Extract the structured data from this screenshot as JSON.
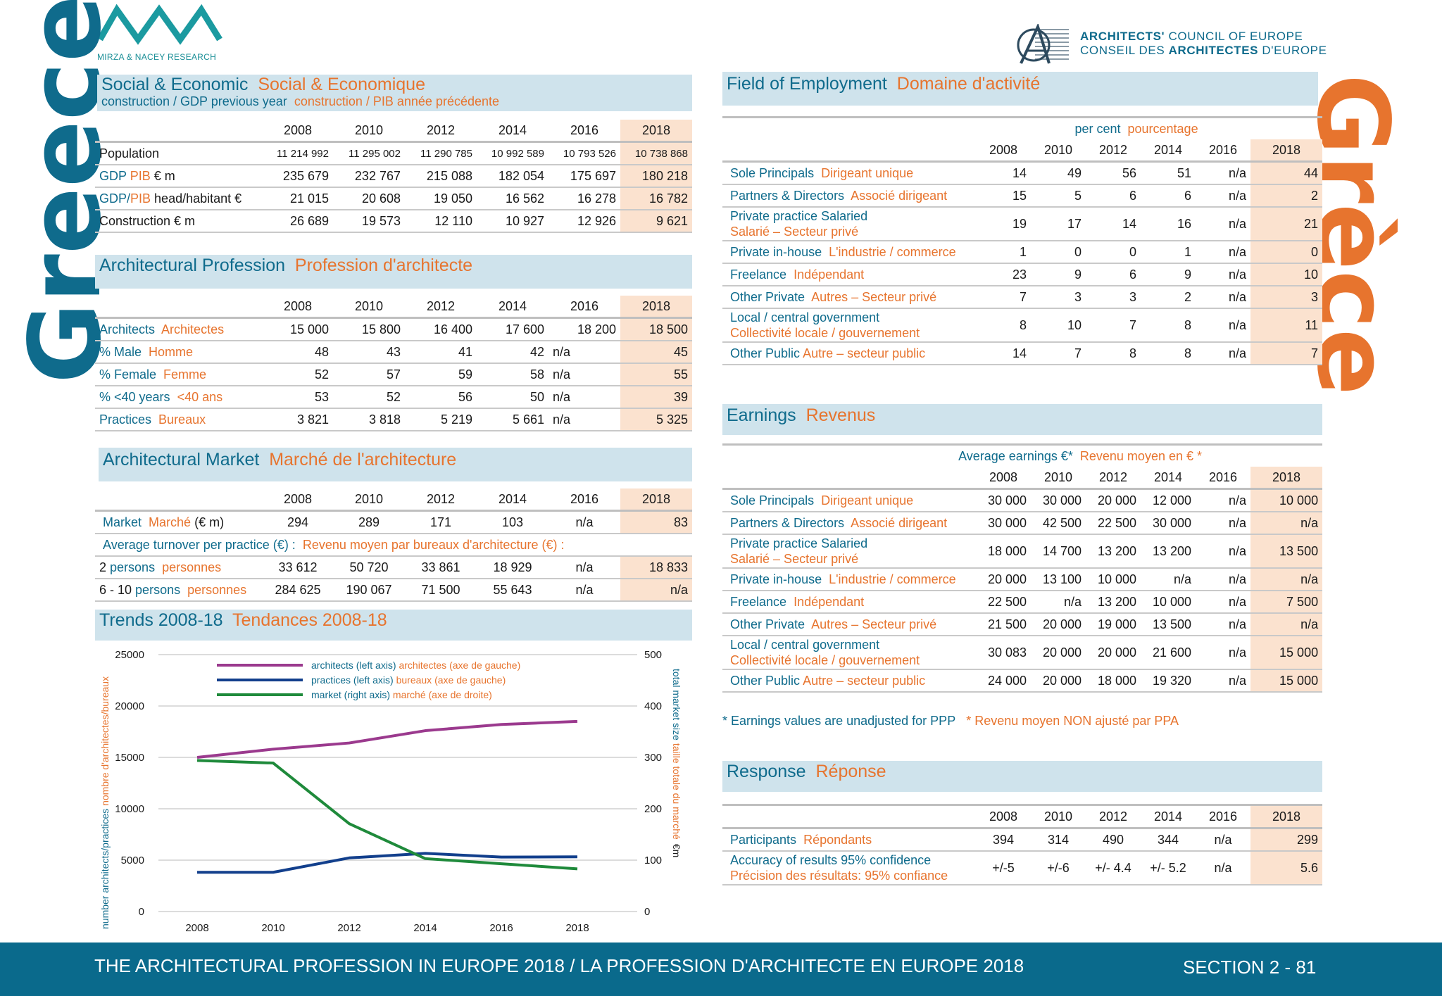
{
  "header": {
    "mnr_label": "MIRZA & NACEY RESEARCH",
    "ace_line1_prefix": "ARCHITECTS'",
    "ace_line1_suffix": " COUNCIL OF EUROPE",
    "ace_line2_prefix": "CONSEIL DES ",
    "ace_line2_bold": "ARCHITECTES",
    "ace_line2_suffix": " D'EUROPE"
  },
  "side": {
    "en": "Greece",
    "fr": "Grèce"
  },
  "years": [
    "2008",
    "2010",
    "2012",
    "2014",
    "2016",
    "2018"
  ],
  "social": {
    "title_en": "Social & Economic",
    "title_fr": "Social & Economique",
    "sub_en": "construction / GDP previous year",
    "sub_fr": "construction / PIB année précédente",
    "rows": [
      {
        "label_en": "Population",
        "label_fr": "",
        "unit": "",
        "values": [
          "11 214 992",
          "11 295 002",
          "11 290 785",
          "10 992 589",
          "10 793 526",
          "10 738 868"
        ]
      },
      {
        "label_en": "GDP",
        "label_fr": "PIB",
        "unit": "€ m",
        "values": [
          "235 679",
          "232 767",
          "215 088",
          "182 054",
          "175 697",
          "180 218"
        ]
      },
      {
        "label_en": "GDP/",
        "label_fr": "PIB",
        "unit": "head/habitant €",
        "values": [
          "21 015",
          "20 608",
          "19 050",
          "16 562",
          "16 278",
          "16 782"
        ]
      },
      {
        "label_en": "Construction € m",
        "label_fr": "",
        "unit": "",
        "values": [
          "26 689",
          "19 573",
          "12 110",
          "10 927",
          "12 926",
          "9 621"
        ]
      }
    ]
  },
  "profession": {
    "title_en": "Architectural Profession",
    "title_fr": "Profession d'architecte",
    "rows": [
      {
        "label_en": "Architects",
        "label_fr": "Architectes",
        "values": [
          "15 000",
          "15 800",
          "16 400",
          "17 600",
          "18 200",
          "18 500"
        ]
      },
      {
        "label_en": "% Male",
        "label_fr": "Homme",
        "values": [
          "48",
          "43",
          "41",
          "42",
          "n/a",
          "45"
        ]
      },
      {
        "label_en": "% Female",
        "label_fr": "Femme",
        "values": [
          "52",
          "57",
          "59",
          "58",
          "n/a",
          "55"
        ]
      },
      {
        "label_en": "% <40 years",
        "label_fr": "<40 ans",
        "values": [
          "53",
          "52",
          "56",
          "50",
          "n/a",
          "39"
        ]
      },
      {
        "label_en": "Practices",
        "label_fr": "Bureaux",
        "values": [
          "3 821",
          "3 818",
          "5 219",
          "5 661",
          "n/a",
          "5 325"
        ]
      }
    ]
  },
  "market": {
    "title_en": "Architectural Market",
    "title_fr": "Marché de l'architecture",
    "market_row": {
      "label_en": "Market",
      "label_fr": "Marché",
      "unit": "(€ m)",
      "values": [
        "294",
        "289",
        "171",
        "103",
        "n/a",
        "83"
      ]
    },
    "turnover_en": "Average turnover per practice (€) :",
    "turnover_fr": "Revenu moyen par bureaux d'architecture (€) :",
    "rows": [
      {
        "prefix": "2",
        "label_en": "persons",
        "label_fr": "personnes",
        "values": [
          "33 612",
          "50 720",
          "33 861",
          "18 929",
          "n/a",
          "18 833"
        ]
      },
      {
        "prefix": "6 - 10",
        "label_en": "persons",
        "label_fr": "personnes",
        "values": [
          "284 625",
          "190 067",
          "71 500",
          "55 643",
          "n/a",
          "n/a"
        ]
      }
    ]
  },
  "trends": {
    "title_en": "Trends 2008-18",
    "title_fr": "Tendances 2008-18"
  },
  "chart_data": {
    "type": "line",
    "x": [
      "2008",
      "2010",
      "2012",
      "2014",
      "2016",
      "2018"
    ],
    "left_ylim": [
      0,
      25000
    ],
    "left_ticks": [
      "0",
      "5000",
      "10000",
      "15000",
      "20000",
      "25000"
    ],
    "right_ylim": [
      0,
      500
    ],
    "right_ticks": [
      "0",
      "100",
      "200",
      "300",
      "400",
      "500"
    ],
    "ylabel_left_en": "number architects/practices",
    "ylabel_left_fr": "nombre d'architectes/bureaux",
    "ylabel_right_en": "total market size",
    "ylabel_right_fr": "taille totale du marché",
    "ylabel_right_unit": "€m",
    "grid": true,
    "series": [
      {
        "name": "architects (left axis)",
        "name_fr": "architectes (axe de gauche)",
        "axis": "left",
        "color": "#9b3a8e",
        "values": [
          15000,
          15800,
          16400,
          17600,
          18200,
          18500
        ]
      },
      {
        "name": "practices (left axis)",
        "name_fr": "bureaux (axe de gauche)",
        "axis": "left",
        "color": "#123f8c",
        "values": [
          3821,
          3818,
          5219,
          5661,
          5300,
          5325
        ]
      },
      {
        "name": "market (right axis)",
        "name_fr": "marché (axe de droite)",
        "axis": "right",
        "color": "#1f8a3b",
        "values": [
          294,
          289,
          171,
          103,
          93,
          83
        ]
      }
    ]
  },
  "employment": {
    "title_en": "Field of Employment",
    "title_fr": "Domaine d'activité",
    "unit_en": "per cent",
    "unit_fr": "pourcentage",
    "rows": [
      {
        "label_en": "Sole Principals",
        "label_fr": "Dirigeant unique",
        "values": [
          "14",
          "49",
          "56",
          "51",
          "n/a",
          "44"
        ]
      },
      {
        "label_en": "Partners & Directors",
        "label_fr": "Associé  dirigeant",
        "values": [
          "15",
          "5",
          "6",
          "6",
          "n/a",
          "2"
        ]
      },
      {
        "label_en": "Private practice Salaried",
        "label_fr": "Salarié – Secteur privé",
        "values": [
          "19",
          "17",
          "14",
          "16",
          "n/a",
          "21"
        ]
      },
      {
        "label_en": "Private in-house",
        "label_fr": "L'industrie / commerce",
        "values": [
          "1",
          "0",
          "0",
          "1",
          "n/a",
          "0"
        ]
      },
      {
        "label_en": "Freelance",
        "label_fr": "Indépendant",
        "values": [
          "23",
          "9",
          "6",
          "9",
          "n/a",
          "10"
        ]
      },
      {
        "label_en": "Other Private",
        "label_fr": "Autres – Secteur privé",
        "values": [
          "7",
          "3",
          "3",
          "2",
          "n/a",
          "3"
        ]
      },
      {
        "label_en": "Local / central government",
        "label_fr": "Collectivité locale / gouvernement",
        "values": [
          "8",
          "10",
          "7",
          "8",
          "n/a",
          "11"
        ]
      },
      {
        "label_en": "Other Public",
        "label_fr": "Autre – secteur public",
        "values": [
          "14",
          "7",
          "8",
          "8",
          "n/a",
          "7"
        ]
      }
    ]
  },
  "earnings": {
    "title_en": "Earnings",
    "title_fr": "Revenus",
    "unit_en": "Average earnings €*",
    "unit_fr": "Revenu moyen en € *",
    "rows": [
      {
        "label_en": "Sole Principals",
        "label_fr": "Dirigeant unique",
        "values": [
          "30 000",
          "30 000",
          "20 000",
          "12 000",
          "n/a",
          "10 000"
        ]
      },
      {
        "label_en": "Partners & Directors",
        "label_fr": "Associé  dirigeant",
        "values": [
          "30 000",
          "42 500",
          "22 500",
          "30 000",
          "n/a",
          "n/a"
        ]
      },
      {
        "label_en": "Private practice Salaried",
        "label_fr": "Salarié – Secteur privé",
        "values": [
          "18 000",
          "14 700",
          "13 200",
          "13 200",
          "n/a",
          "13 500"
        ]
      },
      {
        "label_en": "Private in-house",
        "label_fr": "L'industrie / commerce",
        "values": [
          "20 000",
          "13 100",
          "10 000",
          "n/a",
          "n/a",
          "n/a"
        ]
      },
      {
        "label_en": "Freelance",
        "label_fr": "Indépendant",
        "values": [
          "22 500",
          "n/a",
          "13 200",
          "10 000",
          "n/a",
          "7 500"
        ]
      },
      {
        "label_en": "Other Private",
        "label_fr": "Autres – Secteur privé",
        "values": [
          "21 500",
          "20 000",
          "19 000",
          "13 500",
          "n/a",
          "n/a"
        ]
      },
      {
        "label_en": "Local / central government",
        "label_fr": "Collectivité locale / gouvernement",
        "values": [
          "30 083",
          "20 000",
          "20 000",
          "21 600",
          "n/a",
          "15 000"
        ]
      },
      {
        "label_en": "Other Public",
        "label_fr": "Autre – secteur public",
        "values": [
          "24 000",
          "20 000",
          "18 000",
          "19 320",
          "n/a",
          "15 000"
        ]
      }
    ],
    "note_en": "* Earnings values are unadjusted for PPP",
    "note_fr": "* Revenu moyen NON ajusté par PPA"
  },
  "response": {
    "title_en": "Response",
    "title_fr": "Réponse",
    "participants": {
      "label_en": "Participants",
      "label_fr": "Répondants",
      "values": [
        "394",
        "314",
        "490",
        "344",
        "n/a",
        "299"
      ]
    },
    "accuracy": {
      "label_en": "Accuracy of results 95% confidence",
      "label_fr": "Précision des résultats: 95% confiance",
      "values": [
        "+/-5",
        "+/-6",
        "+/- 4.4",
        "+/- 5.2",
        "n/a",
        "5.6"
      ]
    }
  },
  "footer": {
    "left": "THE ARCHITECTURAL PROFESSION IN EUROPE 2018 / LA PROFESSION D'ARCHITECTE EN EUROPE 2018",
    "right": "SECTION 2 - 81"
  },
  "colors": {
    "blue": "#0f6b8c",
    "orange": "#e7742e",
    "banner": "#cfe3ec",
    "highlight": "#fbe2cf",
    "footer": "#0a6a8c"
  }
}
